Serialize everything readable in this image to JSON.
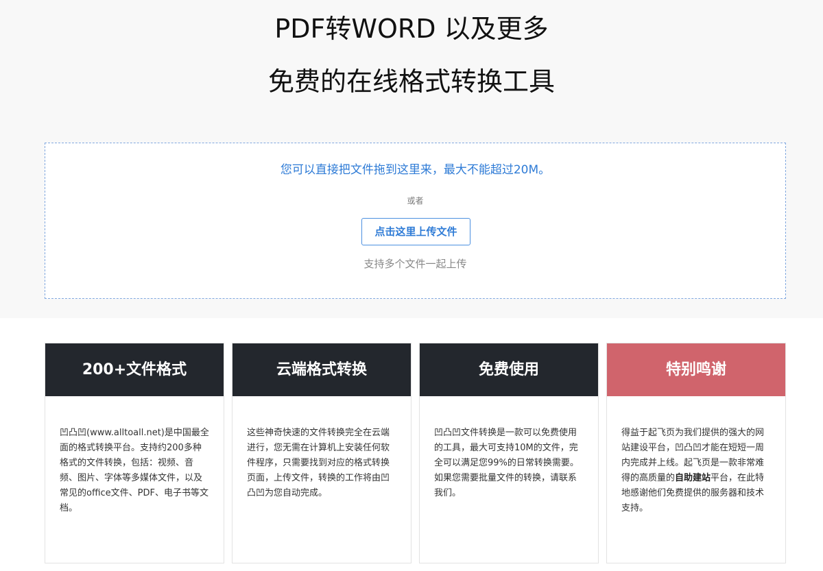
{
  "hero": {
    "title_line1": "PDF转WORD 以及更多",
    "title_line2": "免费的在线格式转换工具"
  },
  "dropzone": {
    "drag_hint": "您可以直接把文件拖到这里来，最大不能超过20M。",
    "or_text": "或者",
    "upload_button_label": "点击这里上传文件",
    "multi_hint": "支持多个文件一起上传"
  },
  "features": [
    {
      "title": "200+文件格式",
      "body": "凹凸凹(www.alltoall.net)是中国最全面的格式转换平台。支持约200多种格式的文件转换，包括：视频、音频、图片、字体等多媒体文件，以及常见的office文件、PDF、电子书等文档。"
    },
    {
      "title": "云端格式转换",
      "body": "这些神奇快速的文件转换完全在云端进行，您无需在计算机上安装任何软件程序，只需要找到对应的格式转换页面，上传文件，转换的工作将由凹凸凹为您自动完成。"
    },
    {
      "title": "免费使用",
      "body": "凹凸凹文件转换是一款可以免费使用的工具，最大可支持10M的文件，完全可以满足您99%的日常转换需要。如果您需要批量文件的转换，请联系我们。"
    },
    {
      "title": "特别鸣谢",
      "body_before": "得益于起飞页为我们提供的强大的网站建设平台，凹凸凹才能在短短一周内完成并上线。起飞页是一款非常难得的高质量的",
      "body_highlight": "自助建站",
      "body_after": "平台，在此特地感谢他们免费提供的服务器和技术支持。",
      "header_color": "#d0646c"
    }
  ]
}
